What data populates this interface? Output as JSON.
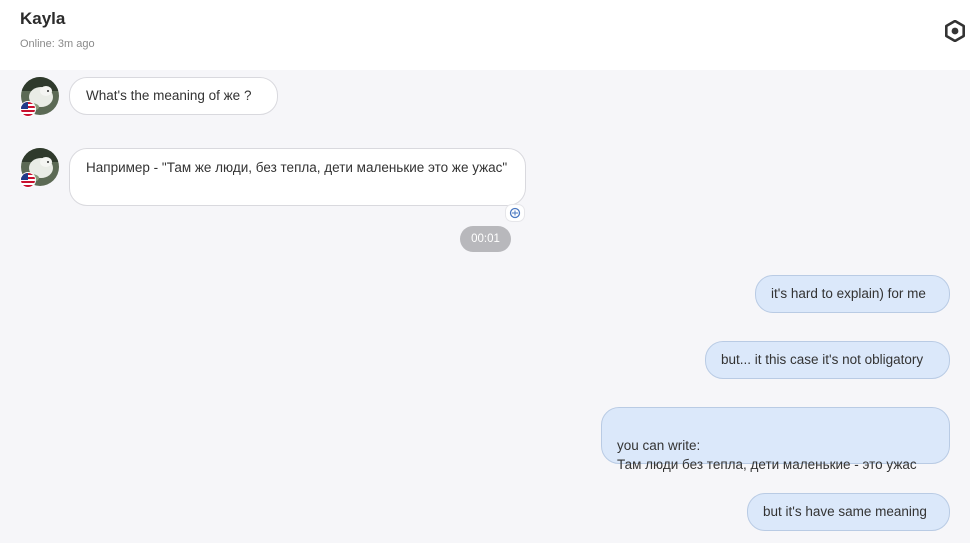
{
  "header": {
    "contact_name": "Kayla",
    "status": "Online: 3m ago",
    "settings_icon": "gear-icon"
  },
  "messages": [
    {
      "direction": "in",
      "text": "What's the meaning of  же ?",
      "flag": "us"
    },
    {
      "direction": "in",
      "text": "Например - \"Там же люди, без тепла, дети маленькие это же ужас\"",
      "flag": "us",
      "translate_icon": "translate-icon"
    },
    {
      "direction": "out",
      "text": "it's hard to explain) for me"
    },
    {
      "direction": "out",
      "text": "but... it this case it's not obligatory"
    },
    {
      "direction": "out",
      "text": "you can write:\nТам люди без тепла, дети маленькие - это ужас"
    },
    {
      "direction": "out",
      "text": "but it's have same meaning"
    }
  ],
  "timestamp_chip": "00:01",
  "colors": {
    "background": "#f6f6f9",
    "outgoing_bubble": "#dbe8fa",
    "incoming_bubble": "#ffffff",
    "timestamp_chip": "#b8b8bc"
  }
}
